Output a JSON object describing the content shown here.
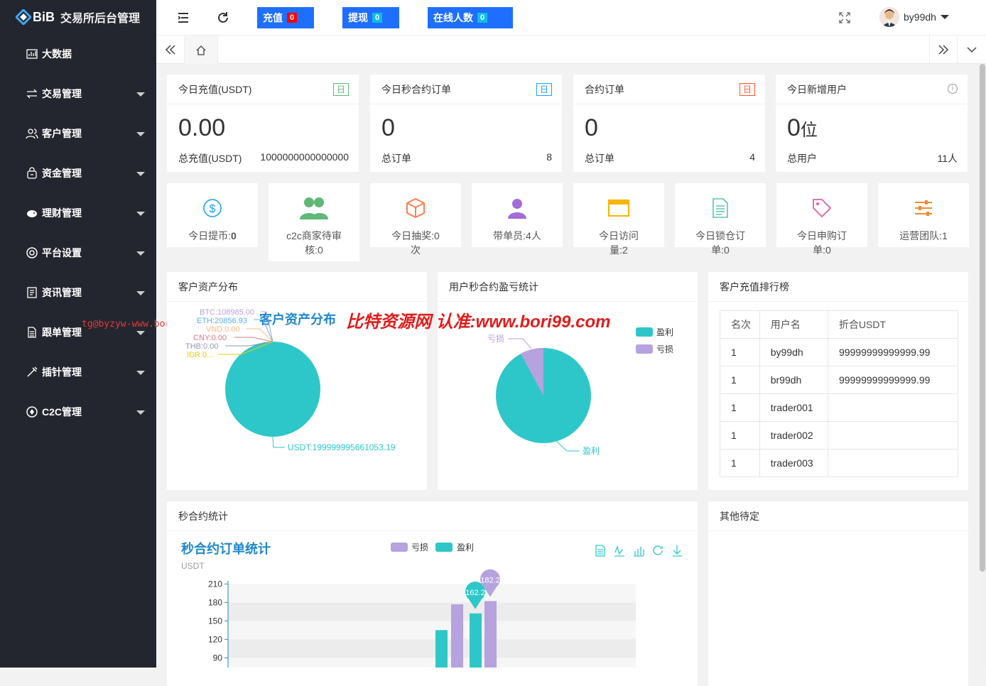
{
  "sidebar": {
    "logo_mark": "BiB",
    "logo_text": "交易所后台管理",
    "items": [
      {
        "label": "大数据",
        "icon": "chart-icon",
        "has_arrow": false
      },
      {
        "label": "交易管理",
        "icon": "exchange-icon",
        "has_arrow": true
      },
      {
        "label": "客户管理",
        "icon": "users-icon",
        "has_arrow": true
      },
      {
        "label": "资金管理",
        "icon": "wallet-icon",
        "has_arrow": true
      },
      {
        "label": "理财管理",
        "icon": "piggy-icon",
        "has_arrow": true
      },
      {
        "label": "平台设置",
        "icon": "settings-icon",
        "has_arrow": true
      },
      {
        "label": "资讯管理",
        "icon": "news-icon",
        "has_arrow": true
      },
      {
        "label": "跟单管理",
        "icon": "document-icon",
        "has_arrow": true
      },
      {
        "label": "插针管理",
        "icon": "needle-icon",
        "has_arrow": true
      },
      {
        "label": "C2C管理",
        "icon": "c2c-icon",
        "has_arrow": true
      }
    ]
  },
  "watermark_left": "tg@byzyw-www.bori99.com",
  "header": {
    "recharge": {
      "label": "充值",
      "count": "0"
    },
    "withdraw": {
      "label": "提现",
      "count": "0"
    },
    "online": {
      "label": "在线人数",
      "count": "0"
    },
    "username": "by99dh"
  },
  "stats": [
    {
      "title": "今日充值(USDT)",
      "badge": "日",
      "badge_color": "#5fb878",
      "value": "0.00",
      "sub_label": "总充值(USDT)",
      "sub_value": "1000000000000000"
    },
    {
      "title": "今日秒合约订单",
      "badge": "日",
      "badge_color": "#1e9fff",
      "value": "0",
      "sub_label": "总订单",
      "sub_value": "8"
    },
    {
      "title": "合约订单",
      "badge": "日",
      "badge_color": "#ff5722",
      "value": "0",
      "sub_label": "总订单",
      "sub_value": "4"
    },
    {
      "title": "今日新增用户",
      "badge": "ⓘ",
      "badge_color": "#999",
      "value": "0",
      "value_unit": "位",
      "sub_label": "总用户",
      "sub_value": "11人"
    }
  ],
  "mini_cards": [
    {
      "label": "今日提币:",
      "value": "0",
      "icon": "dollar-icon"
    },
    {
      "label": "c2c商家待审核:0",
      "value": "",
      "icon": "people-icon"
    },
    {
      "label": "今日抽奖:0次",
      "value": "",
      "icon": "box-icon"
    },
    {
      "label": "带单员:4人",
      "value": "",
      "icon": "person-icon"
    },
    {
      "label": "今日访问量:2",
      "value": "",
      "icon": "window-icon"
    },
    {
      "label": "今日锁仓订单:0",
      "value": "",
      "icon": "file-icon"
    },
    {
      "label": "今日申购订单:0",
      "value": "",
      "icon": "tag-icon"
    },
    {
      "label": "运营团队:1",
      "value": "",
      "icon": "sliders-icon"
    }
  ],
  "asset_card": {
    "title": "客户资产分布",
    "chart_title": "客户资产分布",
    "labels": [
      "BTC:108985.00",
      "ETH:20856.93",
      "VND:0.00",
      "CNY:0.00",
      "THB:0.00",
      "IDR:0...",
      "USDT:199999995661053.19"
    ]
  },
  "watermark_center": "比特资源网 认准:www.bori99.com",
  "pnl_card": {
    "title": "用户秒合约盈亏统计",
    "legend": [
      "盈利",
      "亏损"
    ],
    "label_loss": "亏损",
    "label_profit": "盈利"
  },
  "rank_card": {
    "title": "客户充值排行榜",
    "headers": [
      "名次",
      "用户名",
      "折合USDT"
    ],
    "rows": [
      [
        "1",
        "by99dh",
        "99999999999999.99"
      ],
      [
        "1",
        "br99dh",
        "99999999999999.99"
      ],
      [
        "1",
        "trader001",
        ""
      ],
      [
        "1",
        "trader002",
        ""
      ],
      [
        "1",
        "trader003",
        ""
      ]
    ]
  },
  "seconds_card": {
    "title": "秒合约统计",
    "chart_title": "秒合约订单统计",
    "legend": [
      "亏损",
      "盈利"
    ],
    "unit": "USDT",
    "yticks": [
      "210",
      "180",
      "150",
      "120",
      "90"
    ]
  },
  "other_card": {
    "title": "其他待定"
  },
  "chart_data": [
    {
      "type": "pie",
      "title": "客户资产分布",
      "categories": [
        "BTC",
        "ETH",
        "VND",
        "CNY",
        "THB",
        "IDR",
        "USDT"
      ],
      "values": [
        108985.0,
        20856.93,
        0.0,
        0.0,
        0.0,
        0,
        199999995661053.2
      ]
    },
    {
      "type": "pie",
      "title": "",
      "categories": [
        "盈利",
        "亏损"
      ],
      "values": [
        92,
        8
      ]
    },
    {
      "type": "bar",
      "title": "秒合约订单统计",
      "ylabel": "USDT",
      "ylim": [
        0,
        210
      ],
      "series": [
        {
          "name": "亏损",
          "values": [
            2,
            177,
            182.2
          ]
        },
        {
          "name": "盈利",
          "values": [
            8,
            135,
            162.2
          ]
        }
      ],
      "markers": [
        "162.2",
        "182.2"
      ]
    }
  ]
}
